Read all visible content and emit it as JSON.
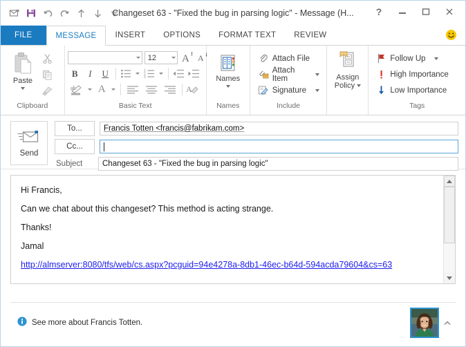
{
  "window": {
    "title": "Changeset 63 - \"Fixed the bug in parsing logic\" - Message (H...",
    "quick_access": [
      {
        "name": "mail-icon",
        "label": "Message"
      },
      {
        "name": "save-icon",
        "label": "Save"
      },
      {
        "name": "undo-icon",
        "label": "Undo"
      },
      {
        "name": "redo-icon",
        "label": "Redo"
      },
      {
        "name": "previous-item-icon",
        "label": "Previous Item"
      },
      {
        "name": "next-item-icon",
        "label": "Next Item"
      },
      {
        "name": "customize-quick-access-icon",
        "label": "Customize Quick Access Toolbar"
      }
    ],
    "controls": {
      "help": "?",
      "minimize": "Minimize",
      "maximize": "Maximize",
      "close": "Close"
    }
  },
  "tabs": [
    {
      "label": "FILE",
      "state": "file"
    },
    {
      "label": "MESSAGE",
      "state": "active"
    },
    {
      "label": "INSERT",
      "state": "normal"
    },
    {
      "label": "OPTIONS",
      "state": "normal"
    },
    {
      "label": "FORMAT TEXT",
      "state": "normal"
    },
    {
      "label": "REVIEW",
      "state": "normal"
    }
  ],
  "ribbon": {
    "clipboard": {
      "label": "Clipboard",
      "paste_label": "Paste",
      "cut_label": "Cut",
      "copy_label": "Copy",
      "format_painter_label": "Format Painter"
    },
    "basic_text": {
      "label": "Basic Text",
      "font_name": "",
      "font_name_placeholder": "",
      "font_size": "12",
      "grow_font_label": "A",
      "shrink_font_label": "A",
      "bold_label": "B",
      "italic_label": "I",
      "underline_label": "U",
      "bullets_label": "Bullets",
      "numbering_label": "Numbering",
      "decrease_indent_label": "Decrease Indent",
      "increase_indent_label": "Increase Indent",
      "text_highlight_label": "Text Highlight Color",
      "font_color_label": "A",
      "align_left_label": "Align Left",
      "align_center_label": "Center",
      "align_right_label": "Align Right",
      "clear_formatting_label": "Clear Formatting"
    },
    "names": {
      "label": "Names",
      "button_label": "Names"
    },
    "include": {
      "label": "Include",
      "items": [
        {
          "label": "Attach File",
          "icon": "paperclip-icon",
          "has_caret": false
        },
        {
          "label": "Attach Item",
          "icon": "attach-item-icon",
          "has_caret": true
        },
        {
          "label": "Signature",
          "icon": "signature-icon",
          "has_caret": true
        }
      ]
    },
    "assign_policy": {
      "label": "",
      "line1": "Assign",
      "line2": "Policy"
    },
    "tags": {
      "label": "Tags",
      "items": [
        {
          "label": "Follow Up",
          "icon": "flag-icon",
          "color": "#c0392b",
          "has_caret": true
        },
        {
          "label": "High Importance",
          "icon": "exclamation-icon",
          "color": "#d9372a",
          "has_caret": false
        },
        {
          "label": "Low Importance",
          "icon": "down-arrow-icon",
          "color": "#2060a8",
          "has_caret": false
        }
      ]
    },
    "smiley_label": "Send a Smile"
  },
  "compose": {
    "send_label": "Send",
    "to_button_label": "To...",
    "cc_button_label": "Cc...",
    "subject_label": "Subject",
    "to_value": "Francis Totten  <francis@fabrikam.com>",
    "cc_value": "",
    "cc_placeholder": "",
    "subject_value": "Changeset 63 - \"Fixed the bug in parsing logic\""
  },
  "body": {
    "paragraphs": [
      "Hi Francis,",
      "Can we chat about this changeset? This method is acting strange.",
      "Thanks!",
      "Jamal"
    ],
    "link_text": "http://almserver:8080/tfs/web/cs.aspx?pcguid=94e4278a-8db1-46ec-b64d-594acda79604&cs=63",
    "scroll": {
      "up_label": "Scroll Up",
      "down_label": "Scroll Down"
    }
  },
  "infobar": {
    "text": "See more about Francis Totten.",
    "info_icon": "info-icon",
    "avatar_label": "Francis Totten photo",
    "expander_label": "Collapse"
  },
  "colors": {
    "file_tab": "#1a7bc1",
    "active_tab_text": "#1a7bc1",
    "window_border": "#b9d4e8",
    "link": "#1d1df0",
    "save_icon": "#8b4a9e"
  }
}
